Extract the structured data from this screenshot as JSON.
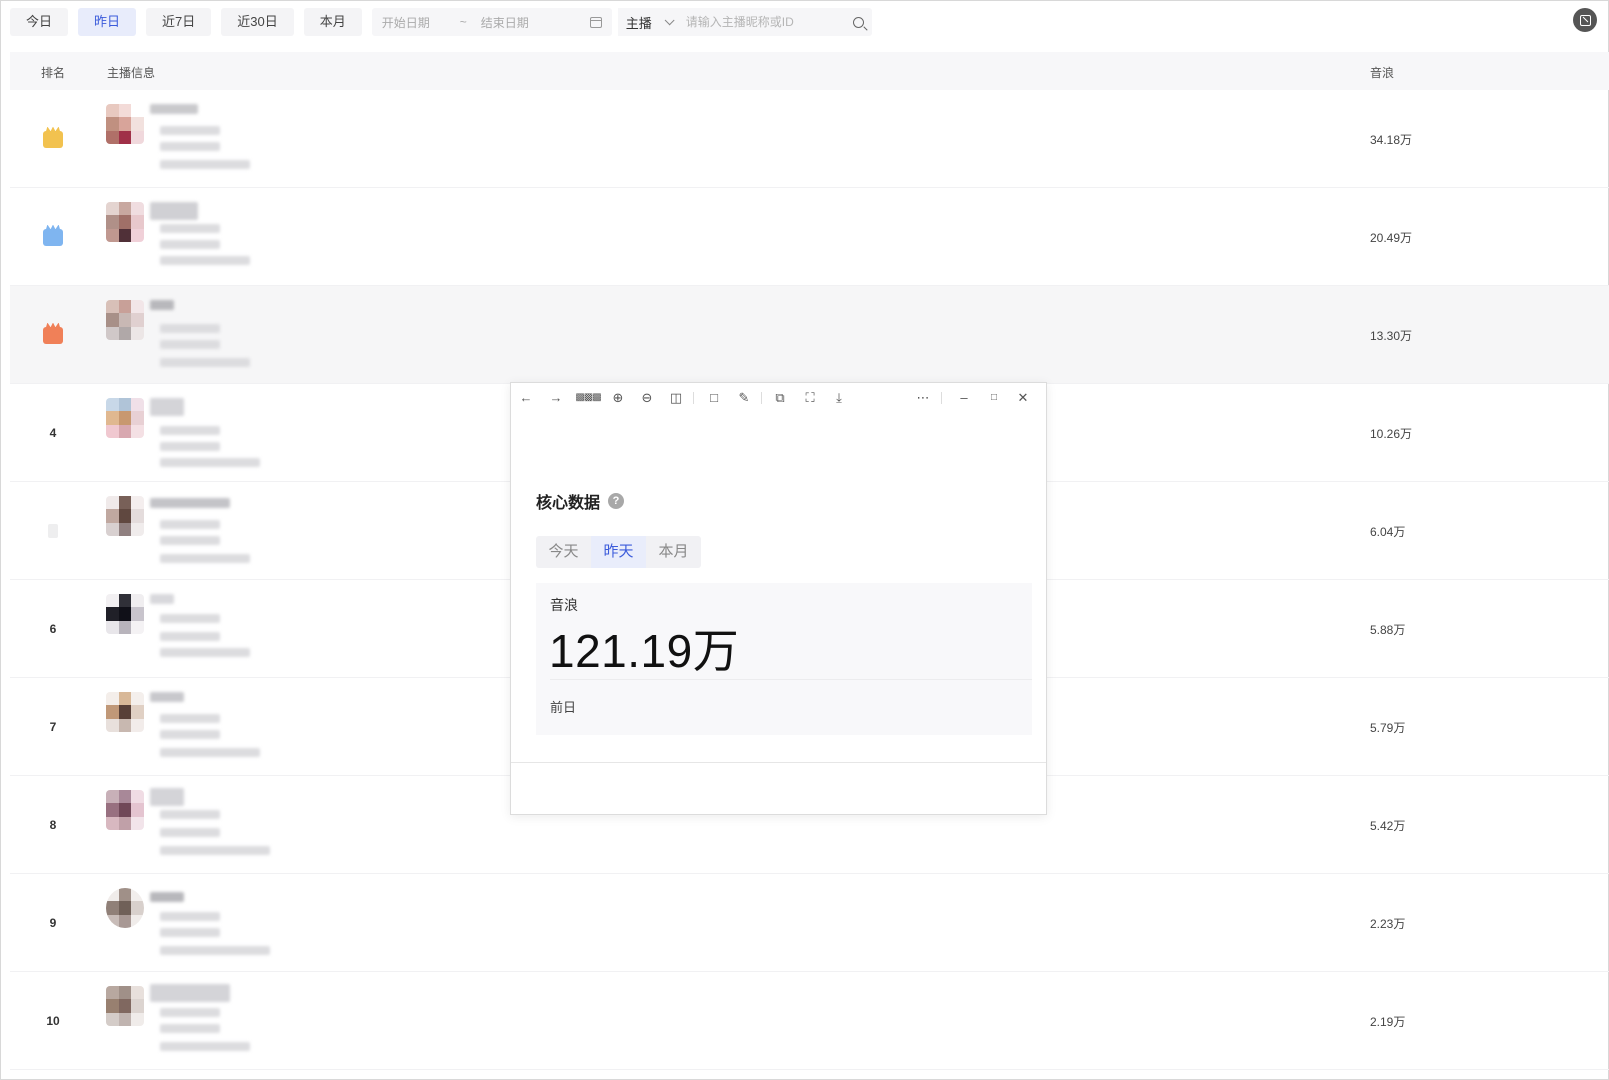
{
  "filters": {
    "ranges": [
      "今日",
      "昨日",
      "近7日",
      "近30日",
      "本月"
    ],
    "active_range": "昨日",
    "start_placeholder": "开始日期",
    "range_separator": "~",
    "end_placeholder": "结束日期",
    "type_select": "主播",
    "search_placeholder": "请输入主播昵称或ID"
  },
  "table": {
    "headers": {
      "rank": "排名",
      "info": "主播信息",
      "value": "音浪"
    },
    "rows": [
      {
        "rank": "1",
        "medal": "gold",
        "value": "34.18万"
      },
      {
        "rank": "2",
        "medal": "silver",
        "value": "20.49万"
      },
      {
        "rank": "3",
        "medal": "bronze",
        "value": "13.30万"
      },
      {
        "rank": "4",
        "medal": "",
        "value": "10.26万"
      },
      {
        "rank": "",
        "medal": "blank",
        "value": "6.04万"
      },
      {
        "rank": "6",
        "medal": "",
        "value": "5.88万"
      },
      {
        "rank": "7",
        "medal": "",
        "value": "5.79万"
      },
      {
        "rank": "8",
        "medal": "",
        "value": "5.42万"
      },
      {
        "rank": "9",
        "medal": "",
        "value": "2.23万"
      },
      {
        "rank": "10",
        "medal": "",
        "value": "2.19万"
      }
    ]
  },
  "viewer": {
    "toolbar_icons": [
      "back-icon",
      "forward-icon",
      "grid-icon",
      "zoom-in-icon",
      "zoom-out-icon",
      "fit-icon",
      "rotate-icon",
      "edit-icon",
      "copy-icon",
      "crop-icon",
      "download-icon",
      "more-icon",
      "minimize-icon",
      "maximize-icon",
      "close-icon"
    ],
    "card_title": "核心数据",
    "tabs": [
      "今天",
      "昨天",
      "本月"
    ],
    "active_tab": "昨天",
    "metric_label": "音浪",
    "metric_value": "121.19万",
    "compare_label": "前日"
  },
  "colors": {
    "accent": "#3b5bdb",
    "gold": "#f2c24f",
    "silver": "#7fb5f0",
    "bronze": "#f08058"
  }
}
